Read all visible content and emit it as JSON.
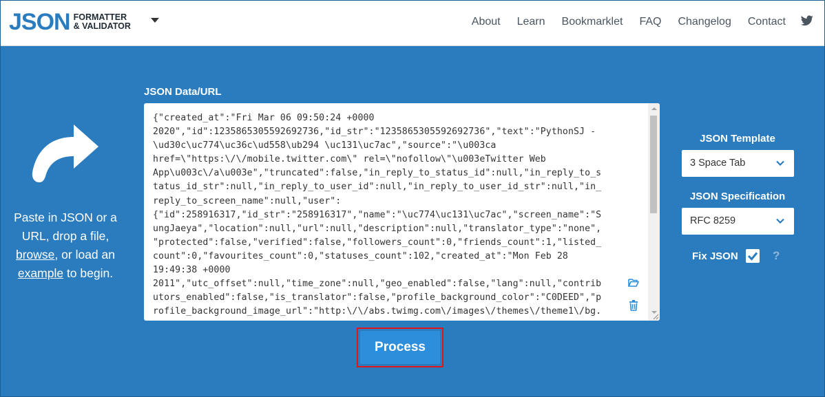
{
  "header": {
    "logo_big": "JSON",
    "logo_line1": "FORMATTER",
    "logo_line2": "& VALIDATOR",
    "nav": [
      "About",
      "Learn",
      "Bookmarklet",
      "FAQ",
      "Changelog",
      "Contact"
    ],
    "twitter_icon": "twitter-icon"
  },
  "intro": {
    "line1": "Paste in JSON or a URL, drop a file, ",
    "browse": "browse",
    "line2": ", or load an ",
    "example": "example",
    "line3": " to begin."
  },
  "editor": {
    "label": "JSON Data/URL",
    "content": "{\"created_at\":\"Fri Mar 06 09:50:24 +0000\n2020\",\"id\":1235865305592692736,\"id_str\":\"1235865305592692736\",\"text\":\"PythonSJ -\n\\ud30c\\uc774\\uc36c\\ud558\\ub294 \\uc131\\uc7ac\",\"source\":\"\\u003ca\nhref=\\\"https:\\/\\/mobile.twitter.com\\\" rel=\\\"nofollow\\\"\\u003eTwitter Web\nApp\\u003c\\/a\\u003e\",\"truncated\":false,\"in_reply_to_status_id\":null,\"in_reply_to_s\ntatus_id_str\":null,\"in_reply_to_user_id\":null,\"in_reply_to_user_id_str\":null,\"in_\nreply_to_screen_name\":null,\"user\":\n{\"id\":258916317,\"id_str\":\"258916317\",\"name\":\"\\uc774\\uc131\\uc7ac\",\"screen_name\":\"S\nungJaeya\",\"location\":null,\"url\":null,\"description\":null,\"translator_type\":\"none\",\n\"protected\":false,\"verified\":false,\"followers_count\":0,\"friends_count\":1,\"listed_\ncount\":0,\"favourites_count\":0,\"statuses_count\":102,\"created_at\":\"Mon Feb 28\n19:49:38 +0000\n2011\",\"utc_offset\":null,\"time_zone\":null,\"geo_enabled\":false,\"lang\":null,\"contrib\nutors_enabled\":false,\"is_translator\":false,\"profile_background_color\":\"C0DEED\",\"p\nrofile_background_image_url\":\"http:\\/\\/abs.twimg.com\\/images\\/themes\\/theme1\\/bg."
  },
  "process_label": "Process",
  "options": {
    "template_label": "JSON Template",
    "template_value": "3 Space Tab",
    "spec_label": "JSON Specification",
    "spec_value": "RFC 8259",
    "fix_label": "Fix JSON",
    "fix_checked": true,
    "help": "?"
  },
  "colors": {
    "background": "#2a7cbf",
    "button": "#2d8fdc",
    "highlight": "#e2151d"
  }
}
